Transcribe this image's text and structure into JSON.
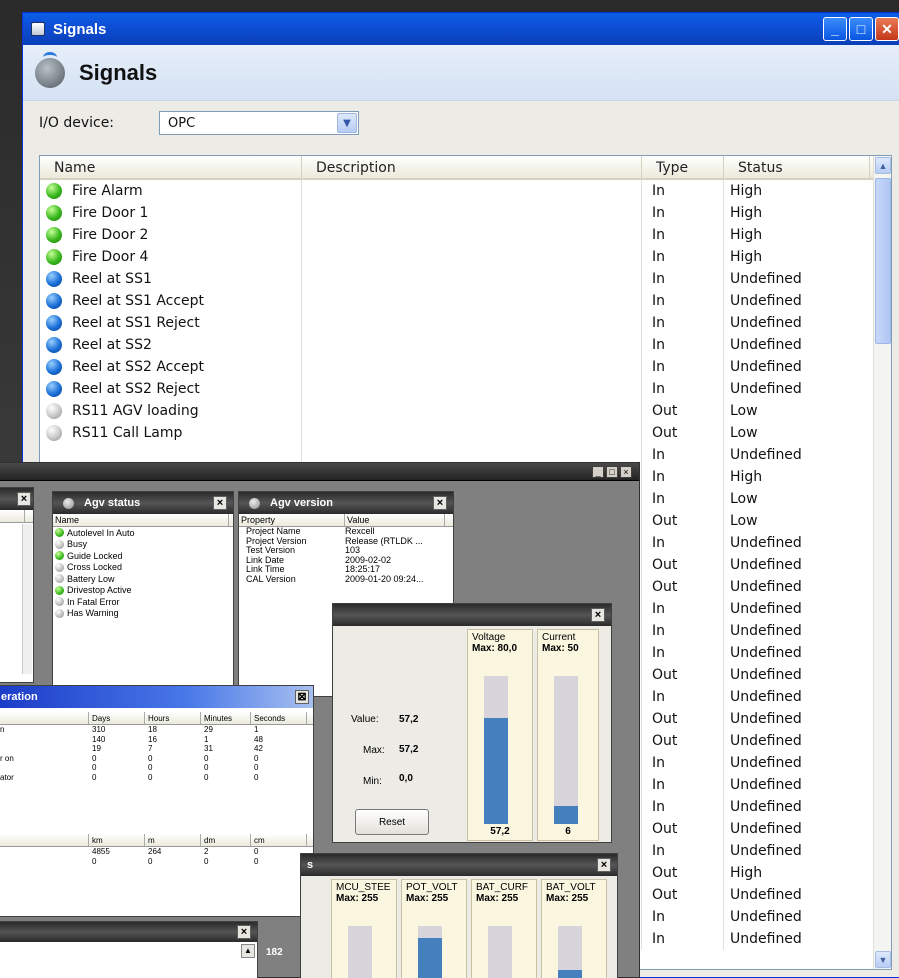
{
  "signals_window": {
    "title": "Signals",
    "header": "Signals",
    "io_label": "I/O device:",
    "io_value": "OPC",
    "columns": [
      "Name",
      "Description",
      "Type",
      "Status"
    ],
    "rows": [
      {
        "name": "Fire Alarm",
        "type": "In",
        "status": "High",
        "led": "green"
      },
      {
        "name": "Fire Door 1",
        "type": "In",
        "status": "High",
        "led": "green"
      },
      {
        "name": "Fire Door 2",
        "type": "In",
        "status": "High",
        "led": "green"
      },
      {
        "name": "Fire Door 4",
        "type": "In",
        "status": "High",
        "led": "green"
      },
      {
        "name": "Reel at SS1",
        "type": "In",
        "status": "Undefined",
        "led": "blue"
      },
      {
        "name": "Reel at SS1 Accept",
        "type": "In",
        "status": "Undefined",
        "led": "blue"
      },
      {
        "name": "Reel at SS1 Reject",
        "type": "In",
        "status": "Undefined",
        "led": "blue"
      },
      {
        "name": "Reel at SS2",
        "type": "In",
        "status": "Undefined",
        "led": "blue"
      },
      {
        "name": "Reel at SS2 Accept",
        "type": "In",
        "status": "Undefined",
        "led": "blue"
      },
      {
        "name": "Reel at SS2 Reject",
        "type": "In",
        "status": "Undefined",
        "led": "blue"
      },
      {
        "name": "RS11 AGV loading",
        "type": "Out",
        "status": "Low",
        "led": "grey"
      },
      {
        "name": "RS11 Call Lamp",
        "type": "Out",
        "status": "Low",
        "led": "grey"
      }
    ],
    "hidden_rows": [
      {
        "type": "In",
        "status": "Undefined"
      },
      {
        "type": "In",
        "status": "High"
      },
      {
        "type": "In",
        "status": "Low"
      },
      {
        "type": "Out",
        "status": "Low"
      },
      {
        "type": "In",
        "status": "Undefined"
      },
      {
        "type": "Out",
        "status": "Undefined"
      },
      {
        "type": "Out",
        "status": "Undefined"
      },
      {
        "type": "In",
        "status": "Undefined"
      },
      {
        "type": "In",
        "status": "Undefined"
      },
      {
        "type": "In",
        "status": "Undefined"
      },
      {
        "type": "Out",
        "status": "Undefined"
      },
      {
        "type": "In",
        "status": "Undefined"
      },
      {
        "type": "Out",
        "status": "Undefined"
      },
      {
        "type": "Out",
        "status": "Undefined"
      },
      {
        "type": "In",
        "status": "Undefined"
      },
      {
        "type": "In",
        "status": "Undefined"
      },
      {
        "type": "In",
        "status": "Undefined"
      },
      {
        "type": "Out",
        "status": "Undefined"
      },
      {
        "type": "In",
        "status": "Undefined"
      },
      {
        "type": "Out",
        "status": "High"
      },
      {
        "type": "Out",
        "status": "Undefined"
      },
      {
        "type": "In",
        "status": "Undefined"
      },
      {
        "type": "In",
        "status": "Undefined"
      }
    ]
  },
  "agv_status": {
    "title": "Agv status",
    "column": "Name",
    "items": [
      {
        "label": "Autolevel In Auto",
        "led": "green"
      },
      {
        "label": "Busy",
        "led": "grey"
      },
      {
        "label": "Guide Locked",
        "led": "green"
      },
      {
        "label": "Cross Locked",
        "led": "grey"
      },
      {
        "label": "Battery Low",
        "led": "grey"
      },
      {
        "label": "Drivestop Active",
        "led": "green"
      },
      {
        "label": "In Fatal Error",
        "led": "grey"
      },
      {
        "label": "Has Warning",
        "led": "grey"
      }
    ]
  },
  "agv_version": {
    "title": "Agv version",
    "columns": [
      "Property",
      "Value"
    ],
    "items": [
      {
        "k": "Project Name",
        "v": "Rexcell"
      },
      {
        "k": "Project Version",
        "v": "Release (RTLDK ..."
      },
      {
        "k": "Test Version",
        "v": "103"
      },
      {
        "k": "Link Date",
        "v": "2009-02-02"
      },
      {
        "k": "Link Time",
        "v": "18:25:17"
      },
      {
        "k": "CAL Version",
        "v": "2009-01-20 09:24..."
      }
    ]
  },
  "battery": {
    "voltage_label": "Voltage",
    "voltage_max": "Max: 80,0",
    "voltage_value": "57,2",
    "voltage_fraction": 0.715,
    "current_label": "Current",
    "current_max": "Max: 50",
    "current_value": "6",
    "current_fraction": 0.12,
    "value_label": "Value:",
    "value": "57,2",
    "max_label": "Max:",
    "max": "57,2",
    "min_label": "Min:",
    "min": "0,0",
    "reset": "Reset"
  },
  "operation": {
    "title_fragment": "eration",
    "time_columns": [
      "Days",
      "Hours",
      "Minutes",
      "Seconds"
    ],
    "time_rows": [
      {
        "label": "n",
        "v": [
          "310",
          "18",
          "29",
          "1"
        ]
      },
      {
        "label": "",
        "v": [
          "140",
          "16",
          "1",
          "48"
        ]
      },
      {
        "label": "",
        "v": [
          "19",
          "7",
          "31",
          "42"
        ]
      },
      {
        "label": "r on",
        "v": [
          "0",
          "0",
          "0",
          "0"
        ]
      },
      {
        "label": "",
        "v": [
          "0",
          "0",
          "0",
          "0"
        ]
      },
      {
        "label": "ator",
        "v": [
          "0",
          "0",
          "0",
          "0"
        ]
      }
    ],
    "dist_columns": [
      "km",
      "m",
      "dm",
      "cm"
    ],
    "dist_rows": [
      {
        "v": [
          "4855",
          "264",
          "2",
          "0"
        ]
      },
      {
        "v": [
          "0",
          "0",
          "0",
          "0"
        ]
      }
    ]
  },
  "analog": {
    "title_fragment": "s",
    "meters": [
      {
        "name": "MCU_STEE",
        "max": "Max: 255",
        "fraction": 0
      },
      {
        "name": "POT_VOLT",
        "max": "Max: 255",
        "fraction": 0.85
      },
      {
        "name": "BAT_CURF",
        "max": "Max: 255",
        "fraction": 0
      },
      {
        "name": "BAT_VOLT",
        "max": "Max: 255",
        "fraction": 0.45
      }
    ]
  },
  "bottom_panel": {
    "value": "182"
  }
}
